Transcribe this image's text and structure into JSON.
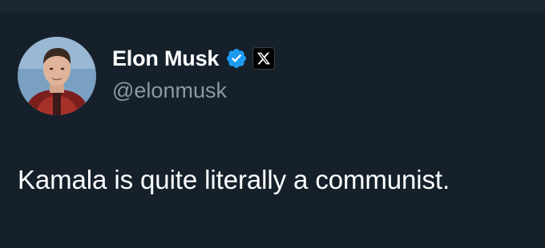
{
  "author": {
    "display_name": "Elon Musk",
    "handle": "@elonmusk",
    "avatar": "profile-photo",
    "verified": true,
    "affiliation_badge": "x-logo-icon"
  },
  "tweet": {
    "text": "Kamala is quite literally a communist."
  },
  "colors": {
    "background": "#15202b",
    "name": "#ffffff",
    "handle": "#8b98a5",
    "verified": "#1d9bf0"
  }
}
